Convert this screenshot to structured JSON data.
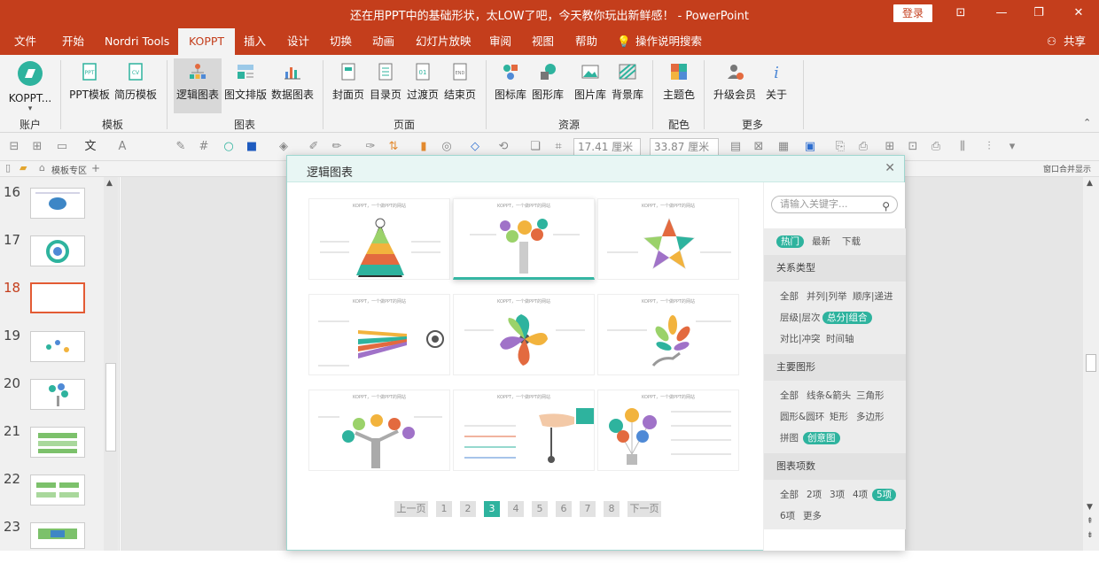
{
  "window": {
    "title": "还在用PPT中的基础形状，太LOW了吧，今天教你玩出新鲜感！ - PowerPoint",
    "login_label": "登录",
    "share_label": "共享"
  },
  "menu": {
    "items": [
      "文件",
      "开始",
      "Nordri Tools",
      "KOPPT",
      "插入",
      "设计",
      "切换",
      "动画",
      "幻灯片放映",
      "审阅",
      "视图",
      "帮助"
    ],
    "active": "KOPPT",
    "tell_me": "操作说明搜索"
  },
  "ribbon": {
    "buttons": [
      {
        "label": "KOPPT..."
      },
      {
        "label": "PPT模板"
      },
      {
        "label": "简历模板"
      },
      {
        "label": "逻辑图表"
      },
      {
        "label": "图文排版"
      },
      {
        "label": "数据图表"
      },
      {
        "label": "封面页"
      },
      {
        "label": "目录页"
      },
      {
        "label": "过渡页"
      },
      {
        "label": "结束页"
      },
      {
        "label": "图标库"
      },
      {
        "label": "图形库"
      },
      {
        "label": "图片库"
      },
      {
        "label": "背景库"
      },
      {
        "label": "主题色"
      },
      {
        "label": "升级会员"
      },
      {
        "label": "关于"
      }
    ],
    "groups": [
      "账户",
      "模板",
      "图表",
      "页面",
      "资源",
      "配色",
      "更多"
    ]
  },
  "format_bar": {
    "width_value": "17.41 厘米",
    "height_value": "33.87 厘米"
  },
  "tabs_row": {
    "template_zone": "模板专区",
    "window_merge": "窗口合并显示"
  },
  "slides": {
    "numbers": [
      "16",
      "17",
      "18",
      "19",
      "20",
      "21",
      "22",
      "23"
    ],
    "current": "18"
  },
  "dialog": {
    "title": "逻辑图表",
    "card_caption": "KOPPT，一个做PPT的网站",
    "pagination": {
      "prev": "上一页",
      "pages": [
        "1",
        "2",
        "3",
        "4",
        "5",
        "6",
        "7",
        "8"
      ],
      "current": "3",
      "next": "下一页"
    },
    "filter": {
      "search_placeholder": "请输入关键字...",
      "sort_tabs": [
        "热门",
        "最新",
        "下载"
      ],
      "sort_active": "热门",
      "relation_title": "关系类型",
      "relation_tags": [
        "全部",
        "并列|列举",
        "顺序|递进",
        "层级|层次",
        "总分|组合",
        "对比|冲突",
        "时间轴"
      ],
      "relation_active": "总分|组合",
      "shape_title": "主要图形",
      "shape_tags": [
        "全部",
        "线条&箭头",
        "三角形",
        "圆形&圆环",
        "矩形",
        "多边形",
        "拼图",
        "创意图"
      ],
      "shape_active": "创意图",
      "count_title": "图表项数",
      "count_tags": [
        "全部",
        "2项",
        "3项",
        "4项",
        "5项",
        "6项",
        "更多"
      ],
      "count_active": "5项"
    }
  },
  "colors": {
    "brand": "#c43e1c",
    "teal": "#2eb39e"
  }
}
